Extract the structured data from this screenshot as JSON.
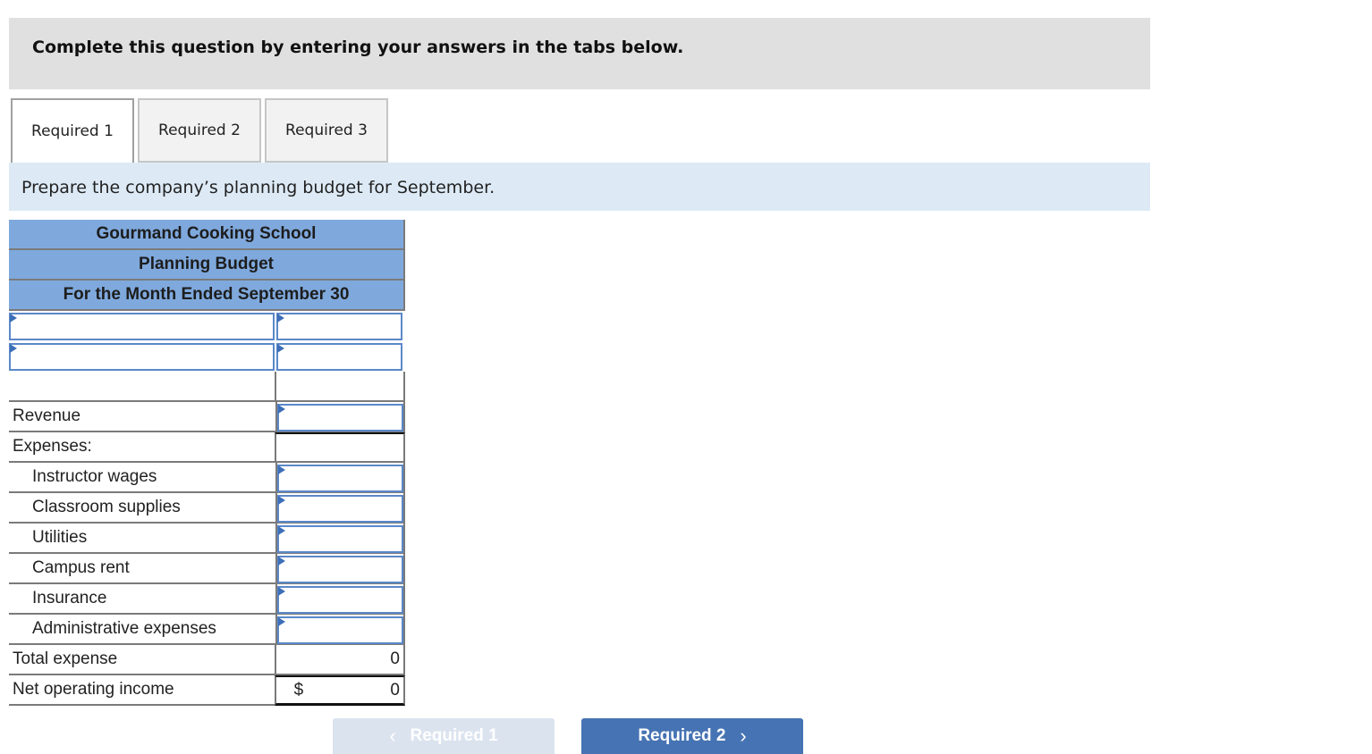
{
  "instructions": "Complete this question by entering your answers in the tabs below.",
  "tabs": [
    {
      "label": "Required 1",
      "active": true
    },
    {
      "label": "Required 2",
      "active": false
    },
    {
      "label": "Required 3",
      "active": false
    }
  ],
  "prompt": "Prepare the company’s planning budget for September.",
  "table": {
    "headers": [
      "Gourmand Cooking School",
      "Planning Budget",
      "For the Month Ended September 30"
    ],
    "input_rows": [
      {
        "label_value": "",
        "amount_value": ""
      },
      {
        "label_value": "",
        "amount_value": ""
      }
    ],
    "rows": [
      {
        "label": "Revenue",
        "value": ""
      },
      {
        "label": "Expenses:",
        "value": ""
      },
      {
        "label": "Instructor wages",
        "value": ""
      },
      {
        "label": "Classroom supplies",
        "value": ""
      },
      {
        "label": "Utilities",
        "value": ""
      },
      {
        "label": "Campus rent",
        "value": ""
      },
      {
        "label": "Insurance",
        "value": ""
      },
      {
        "label": "Administrative expenses",
        "value": ""
      },
      {
        "label": "Total expense",
        "value": "0"
      },
      {
        "label": "Net operating income",
        "currency": "$",
        "value": "0"
      }
    ]
  },
  "nav": {
    "prev_label": "Required 1",
    "next_label": "Required 2",
    "prev_icon": "chevron-left-icon",
    "next_icon": "chevron-right-icon"
  }
}
